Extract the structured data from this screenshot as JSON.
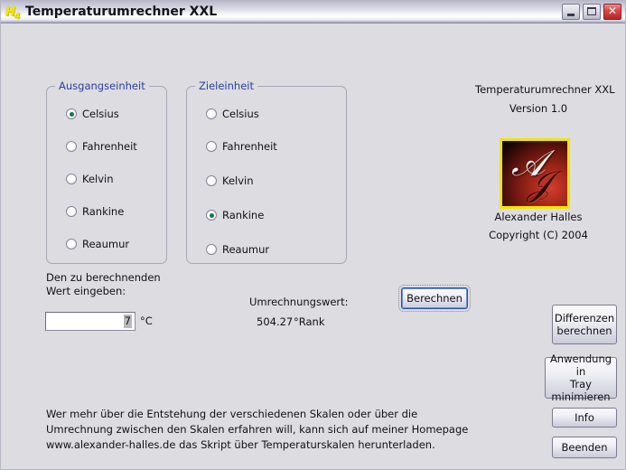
{
  "window": {
    "title": "Temperaturumrechner XXL",
    "icon": "h4-molecule-icon",
    "controls": {
      "minimize": "minimize-icon",
      "maximize": "maximize-icon",
      "close": "✕"
    }
  },
  "source_group": {
    "legend": "Ausgangseinheit",
    "options": [
      {
        "label": "Celsius",
        "checked": true
      },
      {
        "label": "Fahrenheit",
        "checked": false
      },
      {
        "label": "Kelvin",
        "checked": false
      },
      {
        "label": "Rankine",
        "checked": false
      },
      {
        "label": "Reaumur",
        "checked": false
      }
    ]
  },
  "target_group": {
    "legend": "Zieleinheit",
    "options": [
      {
        "label": "Celsius",
        "checked": false
      },
      {
        "label": "Fahrenheit",
        "checked": false
      },
      {
        "label": "Kelvin",
        "checked": false
      },
      {
        "label": "Rankine",
        "checked": true
      },
      {
        "label": "Reaumur",
        "checked": false
      }
    ]
  },
  "input": {
    "prompt": "Den zu berechnenden Wert eingeben:",
    "value": "7",
    "unit": "°C"
  },
  "result": {
    "label": "Umrechnungswert:",
    "value": "504.27",
    "unit": "°Rank"
  },
  "buttons": {
    "calculate": "Berechnen",
    "difference": "Differenzen\nberechnen",
    "tray": "Anwendung in\nTray\nminimieren",
    "info": "Info",
    "quit": "Beenden"
  },
  "about": {
    "title": "Temperaturumrechner XXL",
    "version": "Version 1.0",
    "logo_letter_a": "℘",
    "logo_letter_h": "ℋ",
    "author": "Alexander Halles",
    "copyright": "Copyright (C)  2004"
  },
  "footer": {
    "note": "Wer mehr über die Entstehung der verschiedenen Skalen oder über die Umrechnung zwischen den Skalen erfahren will, kann sich auf meiner Homepage www.alexander-halles.de das Skript über Temperaturskalen herunterladen."
  }
}
